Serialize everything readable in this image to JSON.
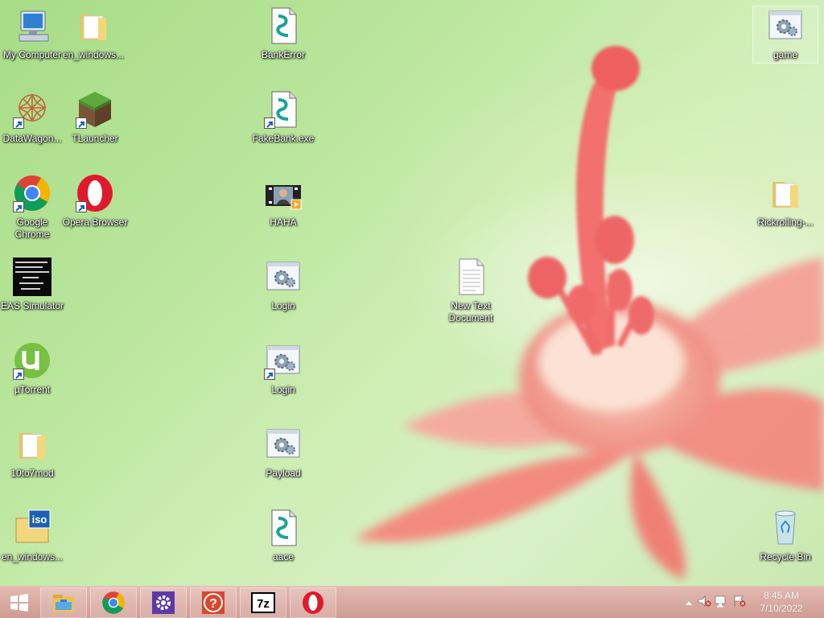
{
  "desktop": {
    "icons": [
      {
        "label": "My Computer"
      },
      {
        "label": "en_windows..."
      },
      {
        "label": "BankError"
      },
      {
        "label": "game"
      },
      {
        "label": "DataWagon..."
      },
      {
        "label": "TLauncher"
      },
      {
        "label": "FakeBank.exe"
      },
      {
        "label": "Google Chrome"
      },
      {
        "label": "Opera Browser"
      },
      {
        "label": "HAHA"
      },
      {
        "label": "Rickrolling-..."
      },
      {
        "label": "EAS Simulator"
      },
      {
        "label": "Login"
      },
      {
        "label": "New Text Document"
      },
      {
        "label": "µTorrent"
      },
      {
        "label": "Login"
      },
      {
        "label": "10to7mod"
      },
      {
        "label": "Payload"
      },
      {
        "label": "en_windows..."
      },
      {
        "label": "aace"
      },
      {
        "label": "Recycle Bin"
      }
    ]
  },
  "taskbar": {
    "pinned": [
      "start-button",
      "file-explorer",
      "chrome",
      "settings",
      "help",
      "7zip",
      "opera"
    ],
    "tray": {
      "time": "8:45 AM",
      "date": "7/10/2022"
    }
  },
  "colors": {
    "taskbar": "#d9a49a",
    "wallpaper_green": "#b9e59b",
    "flower": "#f07a74"
  }
}
